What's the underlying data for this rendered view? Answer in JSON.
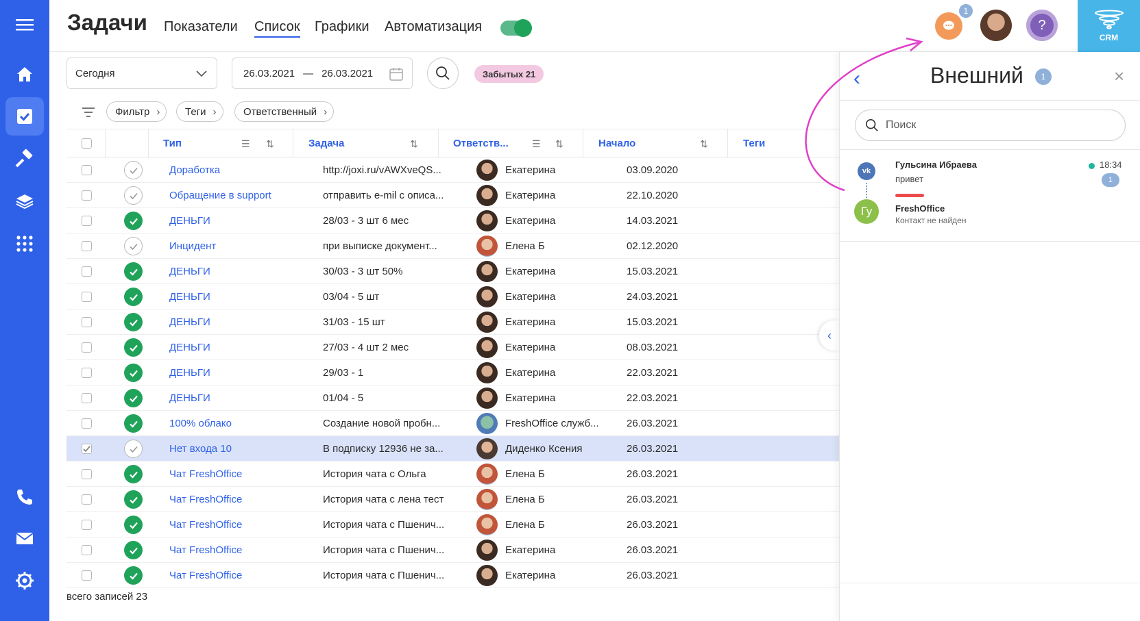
{
  "header": {
    "title": "Задачи",
    "tabs": [
      {
        "label": "Показатели",
        "active": false
      },
      {
        "label": "Список",
        "active": true
      },
      {
        "label": "Графики",
        "active": false
      },
      {
        "label": "Автоматизация",
        "active": false
      }
    ],
    "automation_toggle": true,
    "chat_badge": "1",
    "crm_label": "CRM",
    "help_label": "?"
  },
  "sidebar": {
    "items": [
      {
        "icon": "menu-icon",
        "active": false
      },
      {
        "icon": "home-icon",
        "active": false
      },
      {
        "icon": "tasks-icon",
        "active": true
      },
      {
        "icon": "hammer-icon",
        "active": false
      },
      {
        "icon": "layers-icon",
        "active": false
      },
      {
        "icon": "apps-grid-icon",
        "active": false
      },
      {
        "icon": "phone-icon",
        "active": false
      },
      {
        "icon": "mail-icon",
        "active": false
      },
      {
        "icon": "settings-icon",
        "active": false
      }
    ]
  },
  "filters": {
    "period": "Сегодня",
    "date_from": "26.03.2021",
    "date_separator": "—",
    "date_to": "26.03.2021",
    "forgotten": "Забытых 21",
    "chips": [
      "Фильтр",
      "Теги",
      "Ответственный"
    ]
  },
  "table": {
    "columns": [
      "Тип",
      "Задача",
      "Ответств...",
      "Начало",
      "Теги"
    ],
    "rows": [
      {
        "done": false,
        "type": "Доработка",
        "task": "http://joxi.ru/vAWXveQS...",
        "avatar": "ekaterina",
        "resp": "Екатерина",
        "start": "03.09.2020"
      },
      {
        "done": false,
        "type": "Обращение в support",
        "task": "отправить e-mil с описа...",
        "avatar": "ekaterina",
        "resp": "Екатерина",
        "start": "22.10.2020"
      },
      {
        "done": true,
        "type": "ДЕНЬГИ",
        "task": "28/03 - 3 шт 6 мес",
        "avatar": "ekaterina",
        "resp": "Екатерина",
        "start": "14.03.2021"
      },
      {
        "done": false,
        "type": "Инцидент",
        "task": "при выписке документ...",
        "avatar": "elena",
        "resp": "Елена Б",
        "start": "02.12.2020"
      },
      {
        "done": true,
        "type": "ДЕНЬГИ",
        "task": "30/03 - 3 шт 50%",
        "avatar": "ekaterina",
        "resp": "Екатерина",
        "start": "15.03.2021"
      },
      {
        "done": true,
        "type": "ДЕНЬГИ",
        "task": "03/04 - 5 шт",
        "avatar": "ekaterina",
        "resp": "Екатерина",
        "start": "24.03.2021"
      },
      {
        "done": true,
        "type": "ДЕНЬГИ",
        "task": "31/03 - 15 шт",
        "avatar": "ekaterina",
        "resp": "Екатерина",
        "start": "15.03.2021"
      },
      {
        "done": true,
        "type": "ДЕНЬГИ",
        "task": "27/03 - 4 шт 2 мес",
        "avatar": "ekaterina",
        "resp": "Екатерина",
        "start": "08.03.2021"
      },
      {
        "done": true,
        "type": "ДЕНЬГИ",
        "task": "29/03 - 1",
        "avatar": "ekaterina",
        "resp": "Екатерина",
        "start": "22.03.2021"
      },
      {
        "done": true,
        "type": "ДЕНЬГИ",
        "task": "01/04 - 5",
        "avatar": "ekaterina",
        "resp": "Екатерина",
        "start": "22.03.2021"
      },
      {
        "done": true,
        "type": "100% облако",
        "task": "Создание новой пробн...",
        "avatar": "bot",
        "resp": "FreshOffice служб...",
        "start": "26.03.2021"
      },
      {
        "done": false,
        "selected": true,
        "type": "Нет входа 10",
        "task": "В подписку 12936 не за...",
        "avatar": "ksenia",
        "resp": "Диденко Ксения",
        "start": "26.03.2021"
      },
      {
        "done": true,
        "type": "Чат FreshOffice",
        "task": "История чата с Ольга",
        "avatar": "elena",
        "resp": "Елена Б",
        "start": "26.03.2021"
      },
      {
        "done": true,
        "type": "Чат FreshOffice",
        "task": "История чата с лена тест",
        "avatar": "elena",
        "resp": "Елена Б",
        "start": "26.03.2021"
      },
      {
        "done": true,
        "type": "Чат FreshOffice",
        "task": "История чата с Пшенич...",
        "avatar": "elena",
        "resp": "Елена Б",
        "start": "26.03.2021"
      },
      {
        "done": true,
        "type": "Чат FreshOffice",
        "task": "История чата с Пшенич...",
        "avatar": "ekaterina",
        "resp": "Екатерина",
        "start": "26.03.2021"
      },
      {
        "done": true,
        "type": "Чат FreshOffice",
        "task": "История чата с Пшенич...",
        "avatar": "ekaterina",
        "resp": "Екатерина",
        "start": "26.03.2021"
      }
    ],
    "footer": "всего записей 23"
  },
  "right_panel": {
    "title": "Внешний",
    "title_badge": "1",
    "search_placeholder": "Поиск",
    "conversation": {
      "channel": "vk",
      "name": "Гульсина Ибраева",
      "message": "привет",
      "time": "18:34",
      "unread": "1",
      "avatar_initials": "Гу",
      "company": "FreshOffice",
      "status": "Контакт не найден"
    }
  },
  "colors": {
    "sidebar": "#2f61e8",
    "accent": "#2f61e8",
    "done": "#1fa35a",
    "selected_row": "#d9e2f8",
    "forgotten_badge": "#f2c9e0",
    "crm_tile": "#47b5e8",
    "arrow": "#e040c8"
  }
}
